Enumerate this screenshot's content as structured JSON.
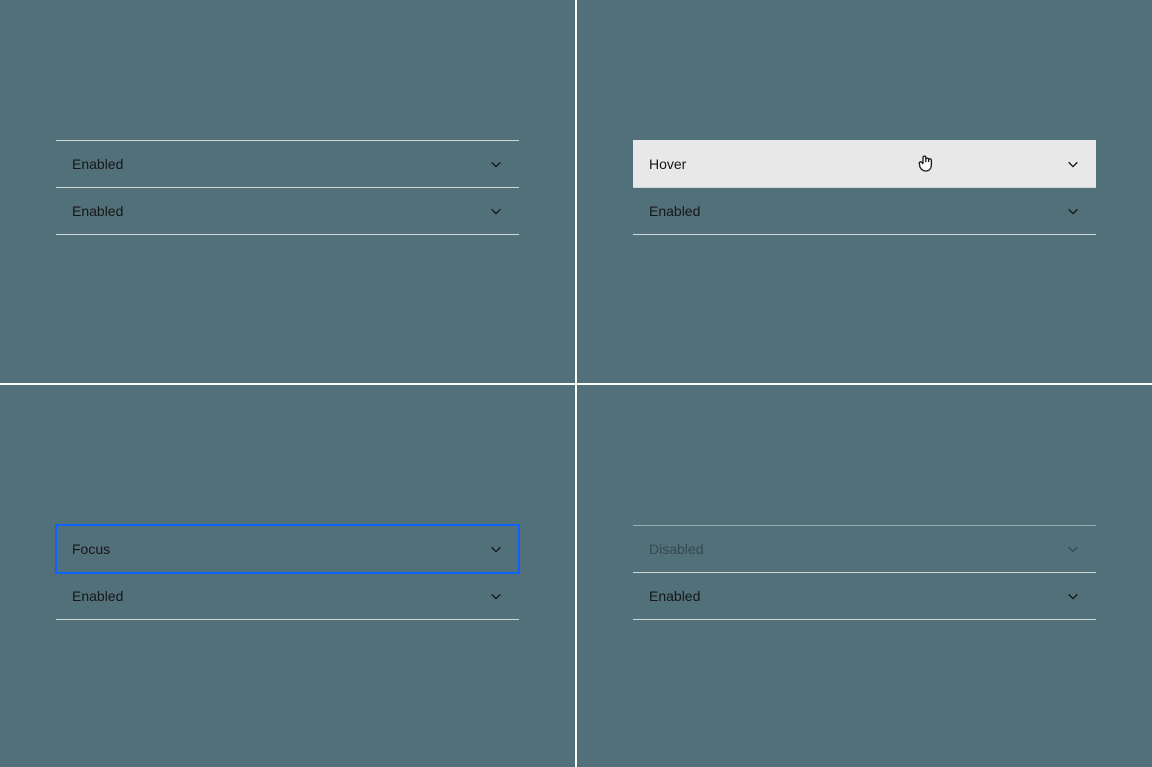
{
  "quadrants": {
    "top_left": {
      "rows": [
        {
          "label": "Enabled",
          "state": "enabled"
        },
        {
          "label": "Enabled",
          "state": "enabled"
        }
      ]
    },
    "top_right": {
      "rows": [
        {
          "label": "Hover",
          "state": "hover",
          "cursor": "hand"
        },
        {
          "label": "Enabled",
          "state": "enabled"
        }
      ]
    },
    "bottom_left": {
      "rows": [
        {
          "label": "Focus",
          "state": "focus"
        },
        {
          "label": "Enabled",
          "state": "enabled"
        }
      ]
    },
    "bottom_right": {
      "rows": [
        {
          "label": "Disabled",
          "state": "disabled"
        },
        {
          "label": "Enabled",
          "state": "enabled"
        }
      ]
    }
  },
  "colors": {
    "background": "#52707a",
    "grid_line": "#ffffff",
    "row_divider": "#d0d7d9",
    "text": "#161616",
    "hover_bg": "#e8e8e8",
    "focus_ring": "#0f62fe"
  }
}
